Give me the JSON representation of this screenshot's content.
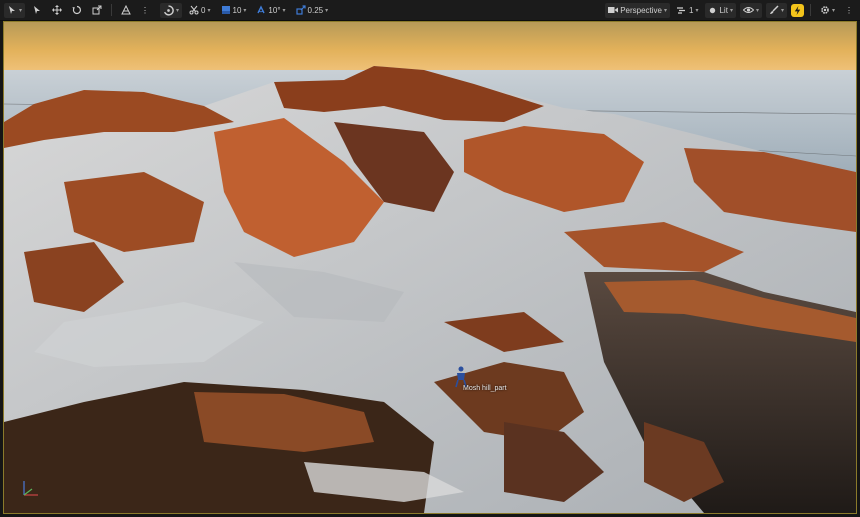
{
  "toolbar": {
    "left": {
      "rotate_value": "0",
      "location_snap": "10",
      "rotation_snap": "10°",
      "scale_snap": "0.25"
    },
    "right": {
      "view_mode": "Perspective",
      "camera_speed": "1",
      "lit_mode": "Lit"
    }
  },
  "viewport": {
    "actor_label": "Mosh hill_part"
  },
  "colors": {
    "accent_yellow": "#f3c41b",
    "viewport_border": "#8b7a2a",
    "toolbar_bg": "#1b1b1b"
  }
}
